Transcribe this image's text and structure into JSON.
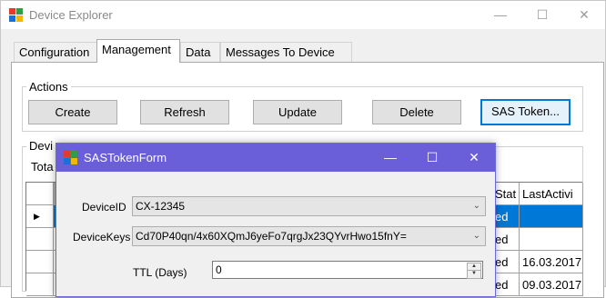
{
  "main_window": {
    "title": "Device Explorer",
    "controls": {
      "minimize": "—",
      "maximize": "☐",
      "close": "✕"
    }
  },
  "tabs": [
    {
      "label": "Configuration",
      "active": false
    },
    {
      "label": "Management",
      "active": true
    },
    {
      "label": "Data",
      "active": false
    },
    {
      "label": "Messages To Device",
      "active": false
    }
  ],
  "actions": {
    "group_label": "Actions",
    "buttons": [
      "Create",
      "Refresh",
      "Update",
      "Delete",
      "SAS Token..."
    ]
  },
  "devices_group": {
    "label_partial": "Devi",
    "total_partial": "Tota"
  },
  "grid": {
    "columns": [
      "Stat",
      "LastActivi"
    ],
    "rows": [
      {
        "indicator": "▶",
        "state": "ed",
        "last_activity": "",
        "selected": true
      },
      {
        "indicator": "",
        "state": "ed",
        "last_activity": "",
        "selected": false
      },
      {
        "indicator": "",
        "state": "ed",
        "last_activity": "16.03.2017",
        "selected": false
      },
      {
        "indicator": "",
        "state": "ed",
        "last_activity": "09.03.2017",
        "selected": false
      }
    ]
  },
  "dialog": {
    "title": "SASTokenForm",
    "controls": {
      "minimize": "—",
      "maximize": "☐",
      "close": "✕"
    },
    "device_id_label": "DeviceID",
    "device_id_value": "CX-12345",
    "device_keys_label": "DeviceKeys",
    "device_keys_value": "Cd70P40qn/4x60XQmJ6yeFo7qrgJx23QYvrHwo15fnY=",
    "ttl_label": "TTL (Days)",
    "ttl_value": "0"
  },
  "colors": {
    "dialog_titlebar": "#6a5ed9",
    "selection": "#0078d7",
    "focus_border": "#0078d7"
  }
}
